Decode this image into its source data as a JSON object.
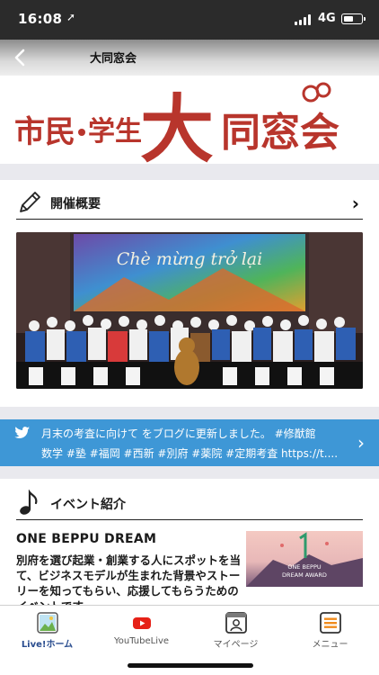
{
  "status_bar": {
    "time": "16:08",
    "network": "4G"
  },
  "navbar": {
    "title": "大同窓会"
  },
  "banner": {
    "text": "市民・学生 大同窓会"
  },
  "overview": {
    "label": "開催概要",
    "photo_caption": "Chè mừng trở lại"
  },
  "tweet": {
    "line1": "月末の考査に向けて をブログに更新しました。 #修猷館",
    "line2": "数学 #塾 #福岡 #西新 #別府 #薬院 #定期考査 https://t...."
  },
  "events": {
    "label": "イベント紹介",
    "title": "ONE BEPPU DREAM",
    "description": "別府を選び起業・創業する人にスポットを当て、ビジネスモデルが生まれた背景やストーリーを知ってもらい、応援してもらうためのイベントです。",
    "image_text": [
      "ONE BEPPU",
      "DREAM AWARD"
    ]
  },
  "tabbar": {
    "items": [
      {
        "label": "Live!ホーム",
        "icon": "photo-icon",
        "active": true
      },
      {
        "label": "YouTubeLive",
        "icon": "youtube-icon",
        "active": false
      },
      {
        "label": "マイページ",
        "icon": "profile-card-icon",
        "active": false
      },
      {
        "label": "メニュー",
        "icon": "menu-icon",
        "active": false
      }
    ]
  },
  "colors": {
    "accent": "#c0392b",
    "tweet_bg": "#3e97d6",
    "tab_active": "#2a4d8f"
  }
}
